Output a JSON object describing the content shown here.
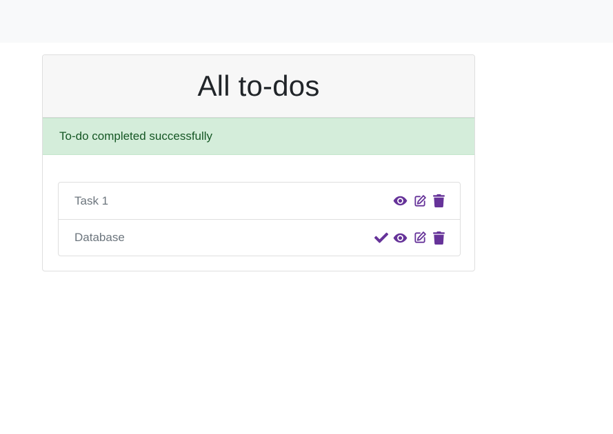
{
  "header": {
    "title": "All to-dos"
  },
  "alert": {
    "message": "To-do completed successfully"
  },
  "todos": [
    {
      "title": "Task 1",
      "actions": [
        "view-icon",
        "edit-icon",
        "delete-icon"
      ]
    },
    {
      "title": "Database",
      "actions": [
        "complete-icon",
        "view-icon",
        "edit-icon",
        "delete-icon"
      ]
    }
  ],
  "colors": {
    "icon": "#663399",
    "alert_bg": "#d4edda",
    "alert_text": "#155724",
    "topbar_bg": "#f8f9fa"
  }
}
